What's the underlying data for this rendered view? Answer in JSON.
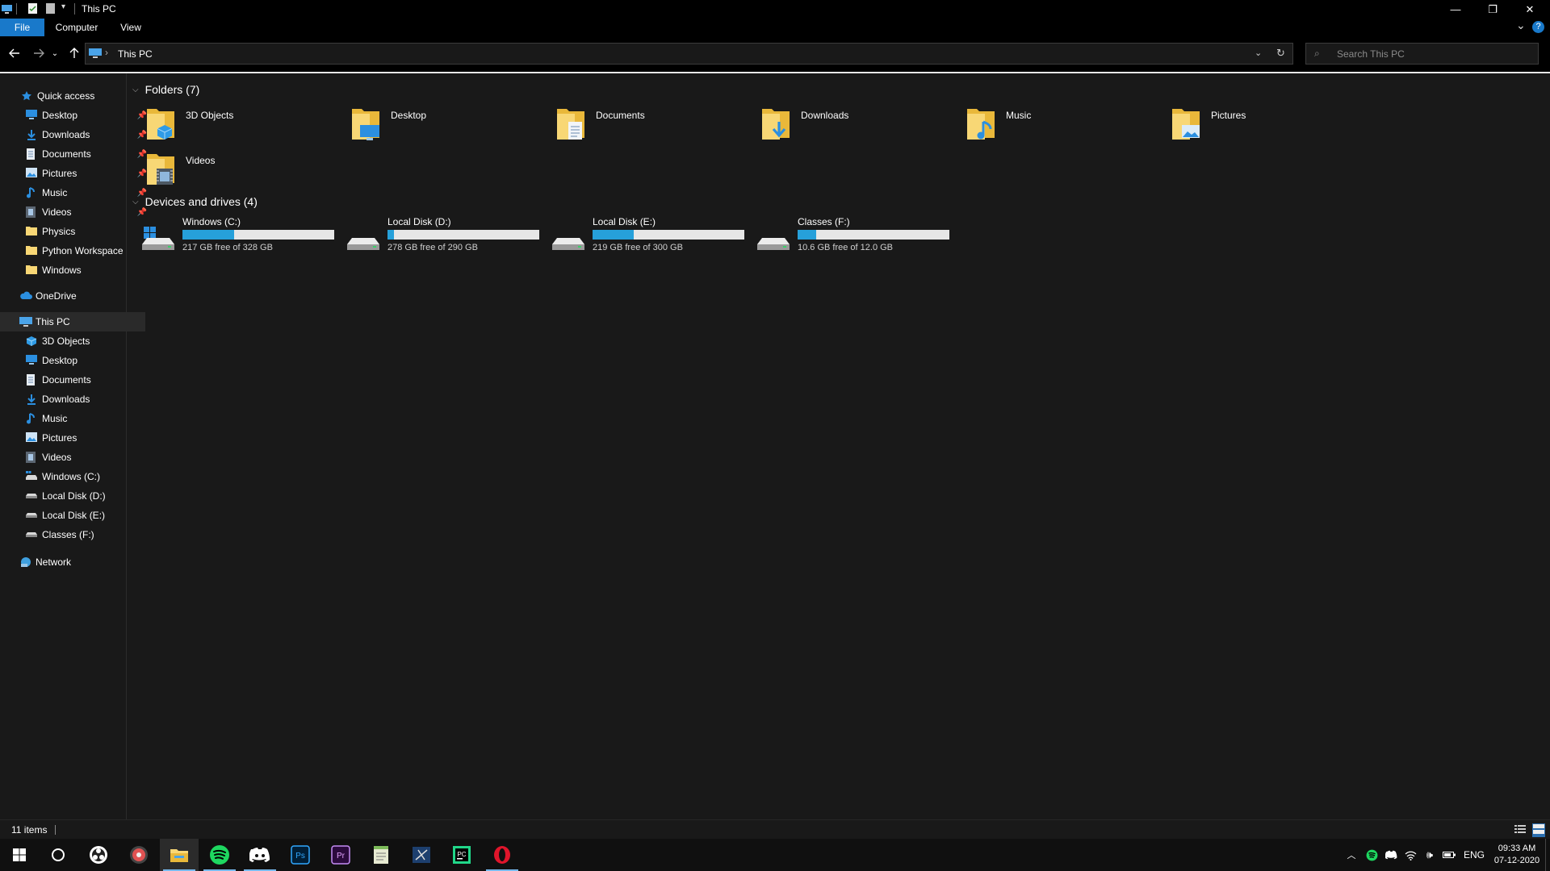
{
  "window": {
    "title": "This PC",
    "controls": {
      "minimize": "—",
      "restore": "❐",
      "close": "✕"
    }
  },
  "ribbon": {
    "tabs": [
      "File",
      "Computer",
      "View"
    ],
    "expand": "⌄",
    "help": "?"
  },
  "address": {
    "path_label": "This PC",
    "search_placeholder": "Search This PC"
  },
  "nav": {
    "quick_access": {
      "label": "Quick access",
      "items": [
        {
          "label": "Desktop",
          "pinned": true
        },
        {
          "label": "Downloads",
          "pinned": true
        },
        {
          "label": "Documents",
          "pinned": true
        },
        {
          "label": "Pictures",
          "pinned": true
        },
        {
          "label": "Music",
          "pinned": true
        },
        {
          "label": "Videos",
          "pinned": true
        },
        {
          "label": "Physics",
          "pinned": false
        },
        {
          "label": "Python Workspace",
          "pinned": false
        },
        {
          "label": "Windows",
          "pinned": false
        }
      ]
    },
    "onedrive": "OneDrive",
    "this_pc": {
      "label": "This PC",
      "items": [
        "3D Objects",
        "Desktop",
        "Documents",
        "Downloads",
        "Music",
        "Pictures",
        "Videos",
        "Windows (C:)",
        "Local Disk (D:)",
        "Local Disk (E:)",
        "Classes (F:)"
      ]
    },
    "network": "Network"
  },
  "content": {
    "folders_header": "Folders (7)",
    "folders": [
      "3D Objects",
      "Desktop",
      "Documents",
      "Downloads",
      "Music",
      "Pictures",
      "Videos"
    ],
    "drives_header": "Devices and drives (4)",
    "drives": [
      {
        "name": "Windows (C:)",
        "free": "217 GB free of 328 GB",
        "used_fraction": 0.34
      },
      {
        "name": "Local Disk (D:)",
        "free": "278 GB free of 290 GB",
        "used_fraction": 0.04
      },
      {
        "name": "Local Disk (E:)",
        "free": "219 GB free of 300 GB",
        "used_fraction": 0.27
      },
      {
        "name": "Classes (F:)",
        "free": "10.6 GB free of 12.0 GB",
        "used_fraction": 0.12
      }
    ]
  },
  "status": {
    "items_count": "11 items"
  },
  "taskbar": {
    "tray": {
      "language": "ENG",
      "time": "09:33 AM",
      "date": "07-12-2020"
    }
  },
  "colors": {
    "accent": "#1979ca",
    "drive_fill": "#26a0da",
    "folder_yellow": "#f8d775",
    "background": "#191919"
  }
}
